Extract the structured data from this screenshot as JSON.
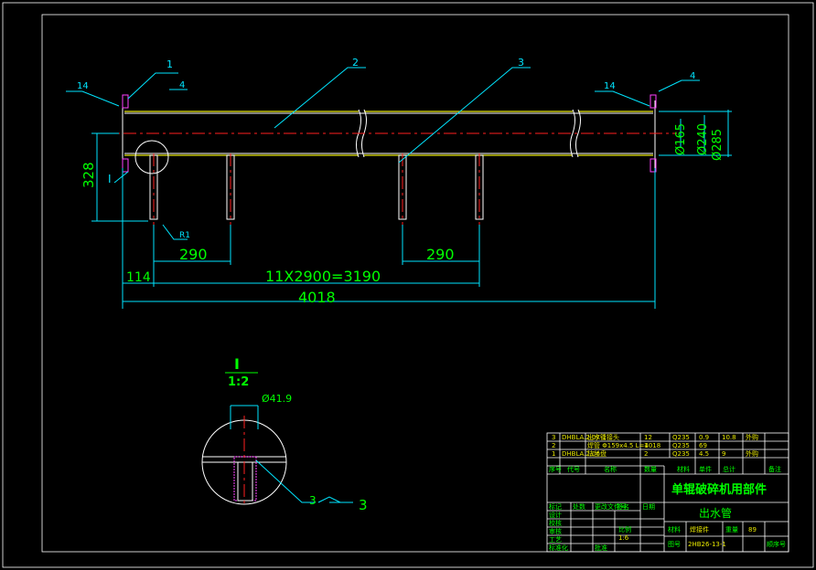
{
  "drawing": {
    "balloons": [
      "1",
      "2",
      "3"
    ],
    "weld_symbols": {
      "left": "14",
      "flange": "4",
      "right": "14",
      "right_flange": "4"
    },
    "dims": {
      "overall": "4018",
      "spacing": "11X2900=3190",
      "left_offset": "114",
      "left_pitch": "290",
      "right_pitch": "290",
      "height": "328",
      "radius": "R1",
      "d165": "Ø165",
      "d240": "Ø240",
      "d285": "Ø285"
    },
    "detail_marker": "I",
    "detail": {
      "title": "I",
      "scale": "1:2",
      "diameter": "Ø41.9",
      "callout": "3",
      "weld": "3"
    }
  },
  "title_block": {
    "project": "单辊破碎机用部件",
    "part_name": "出水管",
    "drawing_no": "2HB26-13-1",
    "bom_rows": [
      {
        "no": "3",
        "code": "DHBLA.2.07-1",
        "name": "出水管接头",
        "qty": "12",
        "material": "Q235",
        "unit_wt": "0.9",
        "total_wt": "10.8",
        "note": "外购"
      },
      {
        "no": "2",
        "code": "",
        "name": "焊管 Φ159x4.5 L=4018",
        "qty": "1",
        "material": "Q235",
        "unit_wt": "69",
        "total_wt": "",
        "note": ""
      },
      {
        "no": "1",
        "code": "DHBLA.2.06",
        "name": "法兰盘",
        "qty": "2",
        "material": "Q235",
        "unit_wt": "4.5",
        "total_wt": "9",
        "note": "外购"
      }
    ],
    "bom_header": [
      "序号",
      "代号",
      "名称",
      "数量",
      "材料",
      "单件",
      "总计",
      "备注"
    ],
    "material_label": "材料",
    "material_value": "焊接件",
    "weight_label": "重量",
    "weight_value": "89",
    "scale_label": "比例",
    "scale_value": "1:6",
    "sheet_label": "图号",
    "seq_label": "顺序号",
    "left_labels": [
      "设计",
      "校核",
      "审核",
      "工艺",
      "标准化",
      "批准"
    ],
    "sign_labels": [
      "标记",
      "处数",
      "更改文件号",
      "签名",
      "日期"
    ]
  }
}
